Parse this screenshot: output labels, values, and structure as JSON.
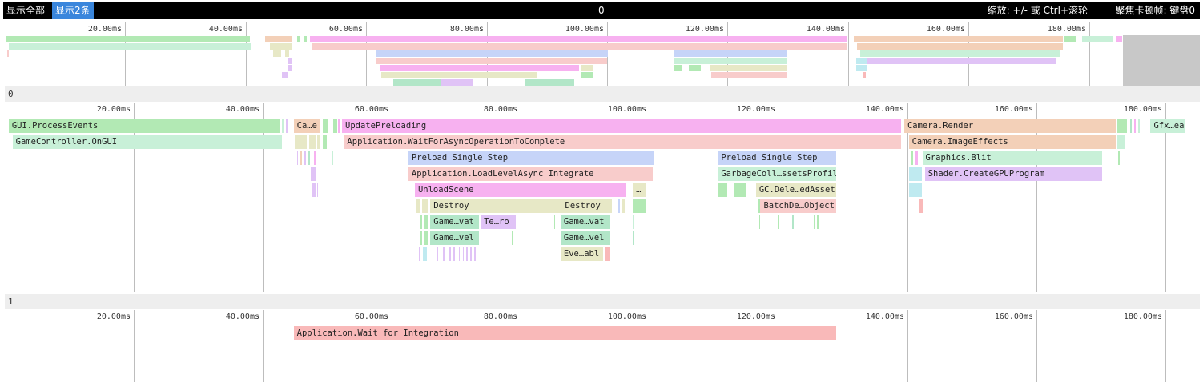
{
  "toolbar": {
    "show_all": "显示全部",
    "show_two": "显示2条",
    "center_value": "0",
    "zoom_hint": "缩放: +/- 或 Ctrl+滚轮",
    "focus_hint": "聚焦卡顿帧: 键盘0"
  },
  "axis_ticks": [
    "20.00ms",
    "40.00ms",
    "60.00ms",
    "80.00ms",
    "100.00ms",
    "120.00ms",
    "140.00ms",
    "160.00ms",
    "180.00ms"
  ],
  "colors": {
    "green": "#b2e9b4",
    "mint": "#c8f0d8",
    "pink": "#f7b1f0",
    "salmon": "#f8cccb",
    "peach": "#f3d0b8",
    "blue": "#c6d4f8",
    "olive": "#e7e8c6",
    "lavender": "#e0c3f6",
    "cyan": "#bfeaf0",
    "seagreen": "#b2e6c8",
    "red": "#f9b9b9",
    "grey": "#d6d6d6"
  },
  "sections": [
    {
      "title": "0"
    },
    {
      "title": "1"
    }
  ],
  "track0_bars": [
    {
      "start": 0.6,
      "end": 42.6,
      "depth": 0,
      "color": "green",
      "label": "GUI.ProcessEvents"
    },
    {
      "start": 44.8,
      "end": 49.0,
      "depth": 0,
      "color": "peach",
      "label": "Ca…e"
    },
    {
      "start": 52.3,
      "end": 139.0,
      "depth": 0,
      "color": "pink",
      "label": "UpdatePreloading"
    },
    {
      "start": 139.5,
      "end": 172.3,
      "depth": 0,
      "color": "peach",
      "label": "Camera.Render"
    },
    {
      "start": 177.7,
      "end": 183.1,
      "depth": 0,
      "color": "mint",
      "label": "Gfx…ea"
    },
    {
      "start": 1.2,
      "end": 43.0,
      "depth": 1,
      "color": "mint",
      "label": "GameController.OnGUI"
    },
    {
      "start": 52.6,
      "end": 139.0,
      "depth": 1,
      "color": "salmon",
      "label": "Application.WaitForAsyncOperationToComplete"
    },
    {
      "start": 140.2,
      "end": 172.3,
      "depth": 1,
      "color": "peach",
      "label": "Camera.ImageEffects"
    },
    {
      "start": 62.6,
      "end": 100.6,
      "depth": 2,
      "color": "blue",
      "label": "Preload Single Step"
    },
    {
      "start": 110.6,
      "end": 128.9,
      "depth": 2,
      "color": "blue",
      "label": "Preload Single Step"
    },
    {
      "start": 142.3,
      "end": 170.2,
      "depth": 2,
      "color": "mint",
      "label": "Graphics.Blit"
    },
    {
      "start": 62.6,
      "end": 100.5,
      "depth": 3,
      "color": "salmon",
      "label": "Application.LoadLevelAsync Integrate"
    },
    {
      "start": 110.6,
      "end": 128.9,
      "depth": 3,
      "color": "mint",
      "label": "GarbageColl…ssetsProfil"
    },
    {
      "start": 142.7,
      "end": 170.2,
      "depth": 3,
      "color": "lavender",
      "label": "Shader.CreateGPUProgram"
    },
    {
      "start": 63.6,
      "end": 96.4,
      "depth": 4,
      "color": "pink",
      "label": "UnloadScene"
    },
    {
      "start": 97.4,
      "end": 99.5,
      "depth": 4,
      "color": "olive",
      "label": "…"
    },
    {
      "start": 116.5,
      "end": 128.9,
      "depth": 4,
      "color": "olive",
      "label": "GC.Dele…edAsset"
    },
    {
      "start": 66.0,
      "end": 86.5,
      "depth": 5,
      "color": "olive",
      "label": "Destroy"
    },
    {
      "start": 86.4,
      "end": 94.1,
      "depth": 5,
      "color": "olive",
      "label": "Destroy"
    },
    {
      "start": 117.2,
      "end": 128.9,
      "depth": 5,
      "color": "salmon",
      "label": "BatchDe…Object"
    },
    {
      "start": 66.0,
      "end": 73.6,
      "depth": 6,
      "color": "seagreen",
      "label": "Game…vat"
    },
    {
      "start": 73.8,
      "end": 79.3,
      "depth": 6,
      "color": "lavender",
      "label": "Te…ro"
    },
    {
      "start": 86.2,
      "end": 93.8,
      "depth": 6,
      "color": "seagreen",
      "label": "Game…vat"
    },
    {
      "start": 66.0,
      "end": 73.6,
      "depth": 7,
      "color": "seagreen",
      "label": "Game…vel"
    },
    {
      "start": 86.2,
      "end": 93.8,
      "depth": 7,
      "color": "seagreen",
      "label": "Game…vel"
    },
    {
      "start": 86.2,
      "end": 92.8,
      "depth": 8,
      "color": "olive",
      "label": "Eve…abl"
    },
    {
      "start": 43.0,
      "end": 43.3,
      "depth": 0,
      "color": "mint",
      "label": ""
    },
    {
      "start": 43.6,
      "end": 43.9,
      "depth": 0,
      "color": "lavender",
      "label": ""
    },
    {
      "start": 49.3,
      "end": 50.2,
      "depth": 0,
      "color": "green",
      "label": ""
    },
    {
      "start": 50.9,
      "end": 51.5,
      "depth": 0,
      "color": "green",
      "label": ""
    },
    {
      "start": 51.7,
      "end": 51.9,
      "depth": 0,
      "color": "pink",
      "label": ""
    },
    {
      "start": 139.2,
      "end": 139.4,
      "depth": 0,
      "color": "pink",
      "label": ""
    },
    {
      "start": 172.6,
      "end": 174.1,
      "depth": 0,
      "color": "green",
      "label": ""
    },
    {
      "start": 174.5,
      "end": 174.8,
      "depth": 0,
      "color": "seagreen",
      "label": ""
    },
    {
      "start": 175.2,
      "end": 175.4,
      "depth": 0,
      "color": "pink",
      "label": ""
    },
    {
      "start": 175.8,
      "end": 176.0,
      "depth": 0,
      "color": "mint",
      "label": ""
    },
    {
      "start": 45.0,
      "end": 46.8,
      "depth": 1,
      "color": "olive",
      "label": ""
    },
    {
      "start": 47.2,
      "end": 48.2,
      "depth": 1,
      "color": "olive",
      "label": ""
    },
    {
      "start": 48.5,
      "end": 48.9,
      "depth": 1,
      "color": "olive",
      "label": ""
    },
    {
      "start": 49.3,
      "end": 50.0,
      "depth": 1,
      "color": "green",
      "label": ""
    },
    {
      "start": 172.6,
      "end": 173.8,
      "depth": 1,
      "color": "mint",
      "label": ""
    },
    {
      "start": 45.3,
      "end": 45.5,
      "depth": 2,
      "color": "lavender",
      "label": ""
    },
    {
      "start": 45.8,
      "end": 46.1,
      "depth": 2,
      "color": "peach",
      "label": ""
    },
    {
      "start": 46.4,
      "end": 46.7,
      "depth": 2,
      "color": "lavender",
      "label": ""
    },
    {
      "start": 47.0,
      "end": 47.3,
      "depth": 2,
      "color": "seagreen",
      "label": ""
    },
    {
      "start": 48.0,
      "end": 48.2,
      "depth": 2,
      "color": "pink",
      "label": ""
    },
    {
      "start": 50.7,
      "end": 50.9,
      "depth": 2,
      "color": "mint",
      "label": ""
    },
    {
      "start": 140.6,
      "end": 140.9,
      "depth": 2,
      "color": "green",
      "label": ""
    },
    {
      "start": 141.2,
      "end": 141.6,
      "depth": 2,
      "color": "pink",
      "label": ""
    },
    {
      "start": 172.7,
      "end": 172.9,
      "depth": 2,
      "color": "green",
      "label": ""
    },
    {
      "start": 47.5,
      "end": 48.3,
      "depth": 3,
      "color": "lavender",
      "label": ""
    },
    {
      "start": 140.3,
      "end": 142.2,
      "depth": 3,
      "color": "cyan",
      "label": ""
    },
    {
      "start": 47.6,
      "end": 48.3,
      "depth": 4,
      "color": "lavender",
      "label": ""
    },
    {
      "start": 48.5,
      "end": 48.6,
      "depth": 4,
      "color": "lavender",
      "label": ""
    },
    {
      "start": 97.4,
      "end": 97.7,
      "depth": 4,
      "color": "olive",
      "label": ""
    },
    {
      "start": 110.6,
      "end": 112.0,
      "depth": 4,
      "color": "green",
      "label": ""
    },
    {
      "start": 113.2,
      "end": 115.0,
      "depth": 4,
      "color": "green",
      "label": ""
    },
    {
      "start": 140.3,
      "end": 142.2,
      "depth": 4,
      "color": "cyan",
      "label": ""
    },
    {
      "start": 63.8,
      "end": 64.3,
      "depth": 5,
      "color": "olive",
      "label": ""
    },
    {
      "start": 64.7,
      "end": 65.7,
      "depth": 5,
      "color": "olive",
      "label": ""
    },
    {
      "start": 95.0,
      "end": 95.4,
      "depth": 5,
      "color": "blue",
      "label": ""
    },
    {
      "start": 95.8,
      "end": 96.2,
      "depth": 5,
      "color": "olive",
      "label": ""
    },
    {
      "start": 97.4,
      "end": 99.4,
      "depth": 5,
      "color": "green",
      "label": ""
    },
    {
      "start": 116.9,
      "end": 117.1,
      "depth": 5,
      "color": "green",
      "label": ""
    },
    {
      "start": 141.9,
      "end": 142.4,
      "depth": 5,
      "color": "red",
      "label": ""
    },
    {
      "start": 64.5,
      "end": 64.7,
      "depth": 6,
      "color": "green",
      "label": ""
    },
    {
      "start": 65.0,
      "end": 65.7,
      "depth": 6,
      "color": "green",
      "label": ""
    },
    {
      "start": 85.2,
      "end": 85.4,
      "depth": 6,
      "color": "green",
      "label": ""
    },
    {
      "start": 97.4,
      "end": 97.6,
      "depth": 6,
      "color": "mint",
      "label": ""
    },
    {
      "start": 117.0,
      "end": 117.2,
      "depth": 6,
      "color": "green",
      "label": ""
    },
    {
      "start": 119.9,
      "end": 120.1,
      "depth": 6,
      "color": "green",
      "label": ""
    },
    {
      "start": 122.1,
      "end": 122.3,
      "depth": 6,
      "color": "seagreen",
      "label": ""
    },
    {
      "start": 125.5,
      "end": 125.7,
      "depth": 6,
      "color": "green",
      "label": ""
    },
    {
      "start": 126.0,
      "end": 126.2,
      "depth": 6,
      "color": "green",
      "label": ""
    },
    {
      "start": 64.5,
      "end": 64.7,
      "depth": 7,
      "color": "green",
      "label": ""
    },
    {
      "start": 65.0,
      "end": 65.7,
      "depth": 7,
      "color": "green",
      "label": ""
    },
    {
      "start": 78.6,
      "end": 78.8,
      "depth": 7,
      "color": "green",
      "label": ""
    },
    {
      "start": 97.4,
      "end": 97.6,
      "depth": 7,
      "color": "seagreen",
      "label": ""
    },
    {
      "start": 64.2,
      "end": 64.4,
      "depth": 8,
      "color": "lavender",
      "label": ""
    },
    {
      "start": 64.8,
      "end": 65.5,
      "depth": 8,
      "color": "cyan",
      "label": ""
    },
    {
      "start": 67.0,
      "end": 67.2,
      "depth": 8,
      "color": "lavender",
      "label": ""
    },
    {
      "start": 68.0,
      "end": 68.2,
      "depth": 8,
      "color": "lavender",
      "label": ""
    },
    {
      "start": 69.0,
      "end": 69.2,
      "depth": 8,
      "color": "lavender",
      "label": ""
    },
    {
      "start": 69.6,
      "end": 69.8,
      "depth": 8,
      "color": "lavender",
      "label": ""
    },
    {
      "start": 70.4,
      "end": 70.6,
      "depth": 8,
      "color": "lavender",
      "label": ""
    },
    {
      "start": 71.0,
      "end": 71.2,
      "depth": 8,
      "color": "lavender",
      "label": ""
    },
    {
      "start": 71.6,
      "end": 71.8,
      "depth": 8,
      "color": "lavender",
      "label": ""
    },
    {
      "start": 72.2,
      "end": 72.4,
      "depth": 8,
      "color": "lavender",
      "label": ""
    },
    {
      "start": 72.8,
      "end": 73.0,
      "depth": 8,
      "color": "lavender",
      "label": ""
    },
    {
      "start": 93.0,
      "end": 93.8,
      "depth": 8,
      "color": "red",
      "label": ""
    }
  ],
  "track1_bars": [
    {
      "start": 44.8,
      "end": 129.0,
      "depth": 0,
      "color": "red",
      "label": "Application.Wait for Integration"
    }
  ],
  "minimap_bars": [
    {
      "start": 0.3,
      "end": 40.7,
      "row": 0,
      "color": "green"
    },
    {
      "start": 0.6,
      "end": 41.0,
      "row": 1,
      "color": "mint"
    },
    {
      "start": 0.4,
      "end": 0.7,
      "row": 2,
      "color": "salmon"
    },
    {
      "start": 43.2,
      "end": 47.8,
      "row": 0,
      "color": "peach"
    },
    {
      "start": 44.0,
      "end": 47.6,
      "row": 1,
      "color": "olive"
    },
    {
      "start": 44.5,
      "end": 45.9,
      "row": 2,
      "color": "olive"
    },
    {
      "start": 46.5,
      "end": 47.2,
      "row": 2,
      "color": "olive"
    },
    {
      "start": 47.0,
      "end": 47.7,
      "row": 3,
      "color": "lavender"
    },
    {
      "start": 47.0,
      "end": 47.6,
      "row": 4,
      "color": "lavender"
    },
    {
      "start": 46.0,
      "end": 47.0,
      "row": 5,
      "color": "lavender"
    },
    {
      "start": 48.5,
      "end": 49.1,
      "row": 0,
      "color": "green"
    },
    {
      "start": 49.6,
      "end": 50.1,
      "row": 0,
      "color": "green"
    },
    {
      "start": 50.6,
      "end": 139.8,
      "row": 0,
      "color": "pink"
    },
    {
      "start": 51.0,
      "end": 139.8,
      "row": 1,
      "color": "salmon"
    },
    {
      "start": 61.6,
      "end": 100.1,
      "row": 2,
      "color": "blue"
    },
    {
      "start": 61.7,
      "end": 100.0,
      "row": 3,
      "color": "salmon"
    },
    {
      "start": 62.4,
      "end": 95.3,
      "row": 4,
      "color": "pink"
    },
    {
      "start": 62.5,
      "end": 88.4,
      "row": 5,
      "color": "olive"
    },
    {
      "start": 64.5,
      "end": 72.5,
      "row": 6,
      "color": "seagreen"
    },
    {
      "start": 72.5,
      "end": 77.8,
      "row": 6,
      "color": "lavender"
    },
    {
      "start": 86.5,
      "end": 94.5,
      "row": 6,
      "color": "seagreen"
    },
    {
      "start": 95.8,
      "end": 97.8,
      "row": 4,
      "color": "olive"
    },
    {
      "start": 95.8,
      "end": 97.8,
      "row": 5,
      "color": "green"
    },
    {
      "start": 111.0,
      "end": 129.8,
      "row": 2,
      "color": "blue"
    },
    {
      "start": 111.0,
      "end": 129.8,
      "row": 3,
      "color": "mint"
    },
    {
      "start": 111.1,
      "end": 112.5,
      "row": 4,
      "color": "green"
    },
    {
      "start": 113.6,
      "end": 115.5,
      "row": 4,
      "color": "green"
    },
    {
      "start": 117.0,
      "end": 129.8,
      "row": 4,
      "color": "olive"
    },
    {
      "start": 117.3,
      "end": 129.8,
      "row": 5,
      "color": "salmon"
    },
    {
      "start": 141.0,
      "end": 175.6,
      "row": 0,
      "color": "peach"
    },
    {
      "start": 141.5,
      "end": 175.6,
      "row": 1,
      "color": "peach"
    },
    {
      "start": 142.0,
      "end": 175.1,
      "row": 2,
      "color": "mint"
    },
    {
      "start": 142.8,
      "end": 174.6,
      "row": 3,
      "color": "lavender"
    },
    {
      "start": 141.3,
      "end": 143.1,
      "row": 3,
      "color": "cyan"
    },
    {
      "start": 141.3,
      "end": 143.1,
      "row": 4,
      "color": "cyan"
    },
    {
      "start": 142.5,
      "end": 143.0,
      "row": 5,
      "color": "red"
    },
    {
      "start": 175.8,
      "end": 177.8,
      "row": 0,
      "color": "green"
    },
    {
      "start": 178.9,
      "end": 184.0,
      "row": 0,
      "color": "mint"
    },
    {
      "start": 184.5,
      "end": 185.5,
      "row": 0,
      "color": "pink"
    }
  ]
}
